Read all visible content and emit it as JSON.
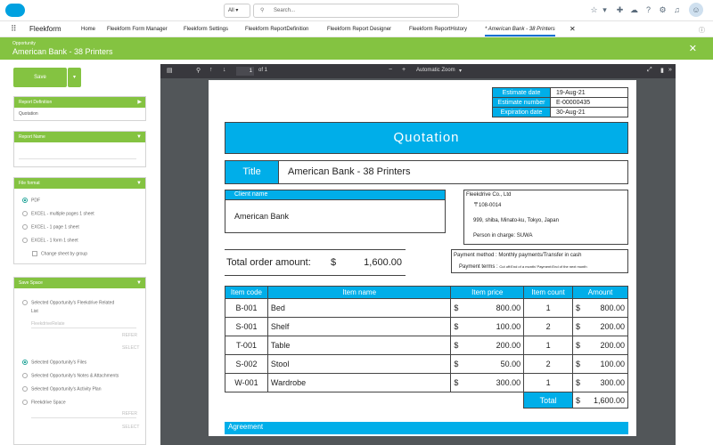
{
  "topbar": {
    "scope": "All",
    "search_placeholder": "Search..."
  },
  "nav": {
    "app_name": "Fleekform",
    "tabs": [
      "Home",
      "Fleekform Form Manager",
      "Fleekform Settings",
      "Fleekform ReportDefinition",
      "Fleekform Report Designer",
      "Fleekform ReportHistory"
    ],
    "active_tab": "* American Bank - 38 Printers"
  },
  "record": {
    "type": "Opportunity",
    "title": "American Bank - 38 Printers"
  },
  "left": {
    "save_label": "Save",
    "report_definition": {
      "label": "Report Definition",
      "value": "Quotation"
    },
    "report_name": {
      "label": "Report Name"
    },
    "file_format": {
      "label": "File format",
      "options": [
        "PDF",
        "EXCEL - multiple pages 1 sheet",
        "EXCEL - 1 page 1 sheet",
        "EXCEL - 1 form 1 sheet"
      ],
      "selected": "PDF",
      "change_sheet": "Change sheet by group"
    },
    "save_space": {
      "label": "Save Space",
      "opt_related": "Selected Opportunity's Fleekdrive Related",
      "opt_related_2": "List",
      "related_placeholder": "FleekdriveRelate",
      "faint_1": "REFER",
      "faint_2": "SELECT",
      "opt_files": "Selected Opportunity's Files",
      "opt_notes": "Selected Opportunity's Notes & Attachments",
      "opt_activity": "Selected Opportunity's Activity Plan",
      "opt_space": "Fleekdrive Space",
      "faint_3": "REFER",
      "faint_4": "SELECT"
    }
  },
  "pdf": {
    "page": "1",
    "of": "of 1",
    "zoom": "Automatic Zoom"
  },
  "quote": {
    "estimate_date_label": "Estimate date",
    "estimate_date": "19-Aug-21",
    "estimate_number_label": "Estimate number",
    "estimate_number": "E-00000435",
    "expiration_date_label": "Expiration date",
    "expiration_date": "30-Aug-21",
    "heading": "Quotation",
    "title_label": "Title",
    "title_value": "American Bank - 38 Printers",
    "client_label": "Client name",
    "client_value": "American Bank",
    "company": "Fleekdrive Co., Ltd",
    "postal": "〒108-0014",
    "address": "999, shiba, Minato-ku, Tokyo, Japan",
    "person": "Person in charge: SUWA",
    "total_label": "Total order amount:",
    "total_currency": "$",
    "total_value": "1,600.00",
    "payment_method": "Payment method : Monthly payments/Transfer in cash",
    "payment_terms_label": "Payment terms :",
    "payment_terms_value": "Cut off:End of a month/ Payment:End of the next month",
    "headers": [
      "Item code",
      "Item name",
      "Item price",
      "Item count",
      "Amount"
    ],
    "rows": [
      {
        "code": "B-001",
        "name": "Bed",
        "price": "800.00",
        "count": "1",
        "amount": "800.00"
      },
      {
        "code": "S-001",
        "name": "Shelf",
        "price": "100.00",
        "count": "2",
        "amount": "200.00"
      },
      {
        "code": "T-001",
        "name": "Table",
        "price": "200.00",
        "count": "1",
        "amount": "200.00"
      },
      {
        "code": "S-002",
        "name": "Stool",
        "price": "50.00",
        "count": "2",
        "amount": "100.00"
      },
      {
        "code": "W-001",
        "name": "Wardrobe",
        "price": "300.00",
        "count": "1",
        "amount": "300.00"
      }
    ],
    "currency": "$",
    "grand_total_label": "Total",
    "grand_total": "1,600.00",
    "agreement": "Agreement"
  },
  "colors": {
    "accent_green": "#84c341",
    "table_blue": "#00aee9"
  }
}
